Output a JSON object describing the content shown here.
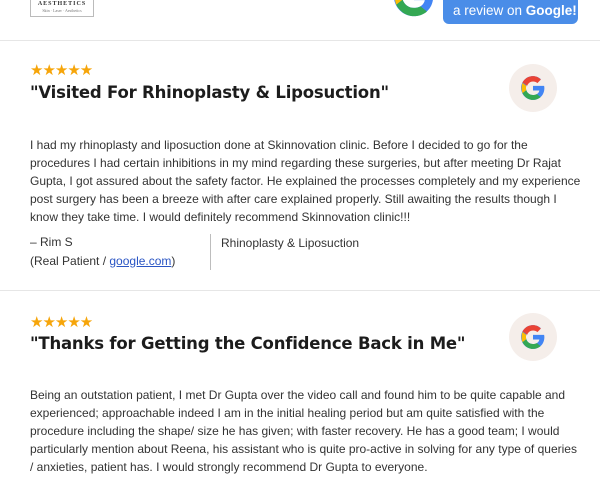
{
  "header": {
    "logo_text": "AESTHETICS",
    "logo_sub": "Skin · Laser · Aesthetics",
    "review_prefix": "a review on ",
    "review_brand": "Google!"
  },
  "reviews": [
    {
      "stars": "★★★★★",
      "title": "\"Visited For Rhinoplasty & Liposuction\"",
      "text": "I had my rhinoplasty and liposuction done at Skinnovation clinic. Before I decided to go for the procedures I had certain inhibitions in my mind regarding these surgeries, but after meeting Dr Rajat Gupta, I got assured about the safety factor. He explained the processes completely and my experience post surgery has been a breeze with after care explained properly. Still awaiting the results though I know they take time. I would definitely recommend Skinnovation clinic!!!",
      "author": "– Rim S",
      "source_prefix": "(Real Patient / ",
      "source_link": "google.com",
      "source_suffix": ")",
      "procedure": "Rhinoplasty & Liposuction"
    },
    {
      "stars": "★★★★★",
      "title": "\"Thanks for Getting the Confidence Back in Me\"",
      "text": "Being an outstation patient, I met Dr Gupta over the video call and found him to be quite capable and experienced; approachable indeed I am in the initial healing period but am quite satisfied with the procedure including the shape/ size he has given; with faster recovery. He has a good team; I would particularly mention about Reena, his assistant who is quite pro-active in solving for any type of queries / anxieties, patient has. I would strongly recommend Dr Gupta to everyone."
    }
  ],
  "colors": {
    "star": "#f6a50a",
    "button": "#4a8de8",
    "link": "#2a55c4"
  },
  "icons": [
    "google-g-icon",
    "star-icon"
  ]
}
